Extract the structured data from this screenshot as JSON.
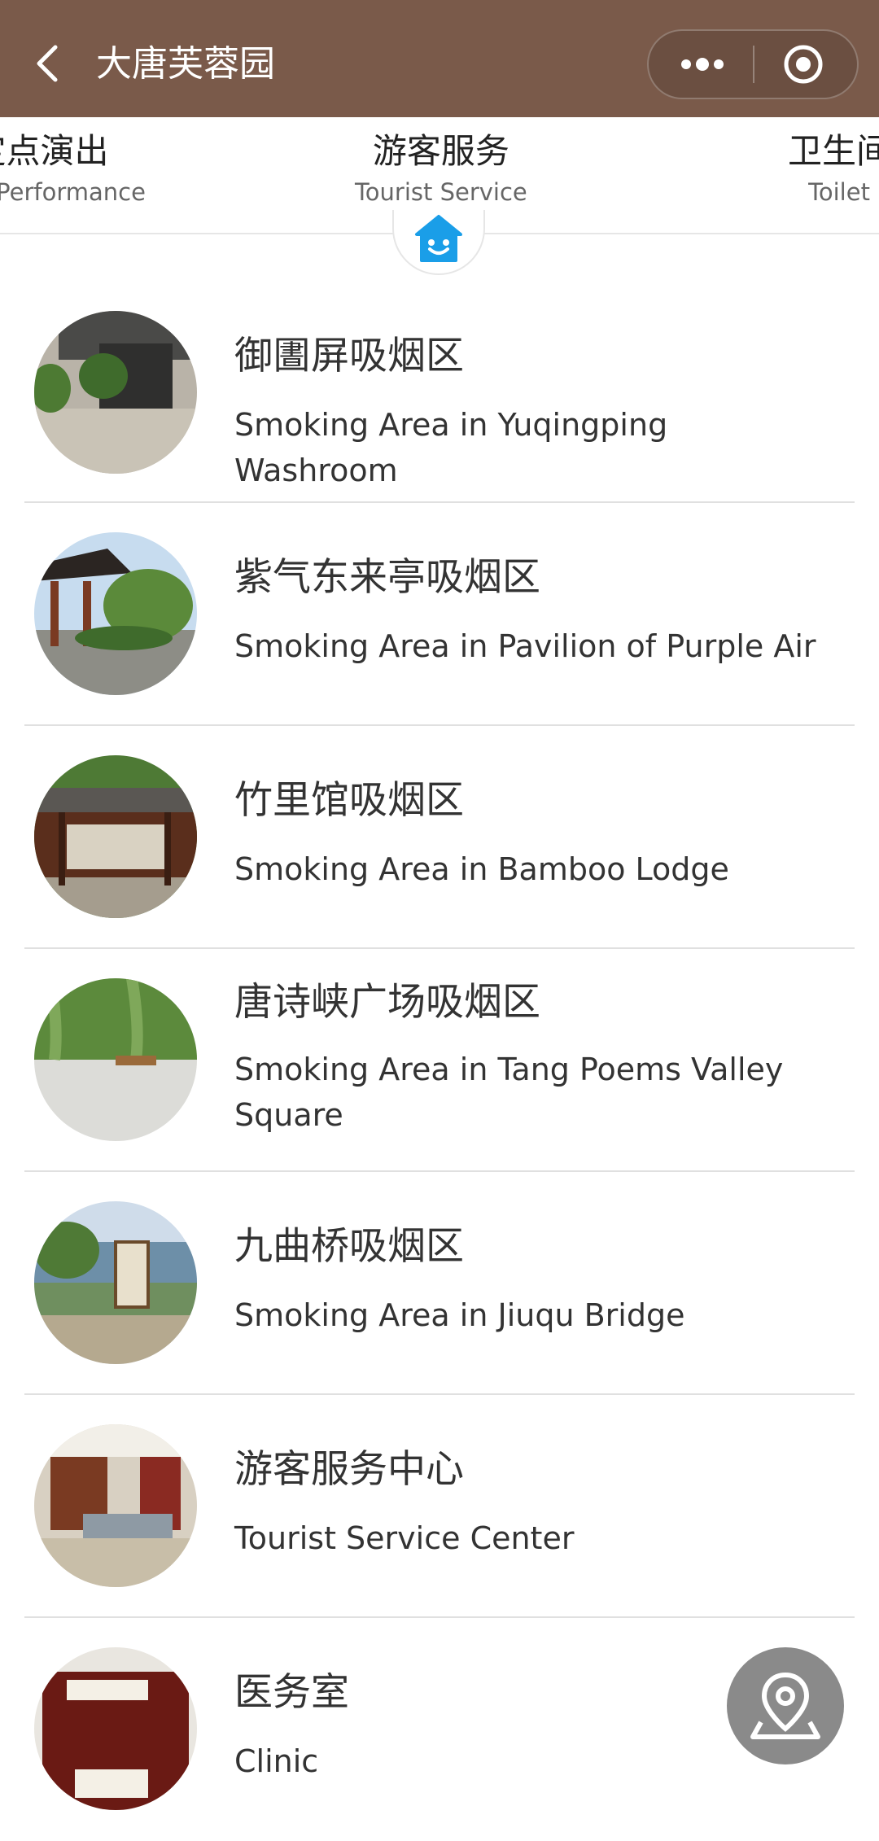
{
  "header": {
    "title": "大唐芙蓉园",
    "bg_color": "#7a5a4a"
  },
  "tabs": [
    {
      "zh": "定点演出",
      "en": "Spot Performance"
    },
    {
      "zh": "游客服务",
      "en": "Tourist Service"
    },
    {
      "zh": "卫生间",
      "en": "Toilet"
    }
  ],
  "accent_color": "#1a9ee8",
  "items": [
    {
      "zh": "御圕屏吸烟区",
      "en": "Smoking Area in Yuqingping Washroom"
    },
    {
      "zh": "紫气东来亭吸烟区",
      "en": "Smoking Area in Pavilion of Purple Air"
    },
    {
      "zh": "竹里馆吸烟区",
      "en": "Smoking Area in Bamboo Lodge"
    },
    {
      "zh": "唐诗峡广场吸烟区",
      "en": "Smoking Area in Tang Poems Valley Square"
    },
    {
      "zh": "九曲桥吸烟区",
      "en": "Smoking Area in Jiuqu Bridge"
    },
    {
      "zh": "游客服务中心",
      "en": "Tourist Service Center"
    },
    {
      "zh": "医务室",
      "en": "Clinic"
    }
  ],
  "icons": {
    "back": "chevron-left-icon",
    "more": "more-dots-icon",
    "close": "target-circle-icon",
    "home": "smiley-house-icon",
    "fab": "location-pin-icon"
  }
}
